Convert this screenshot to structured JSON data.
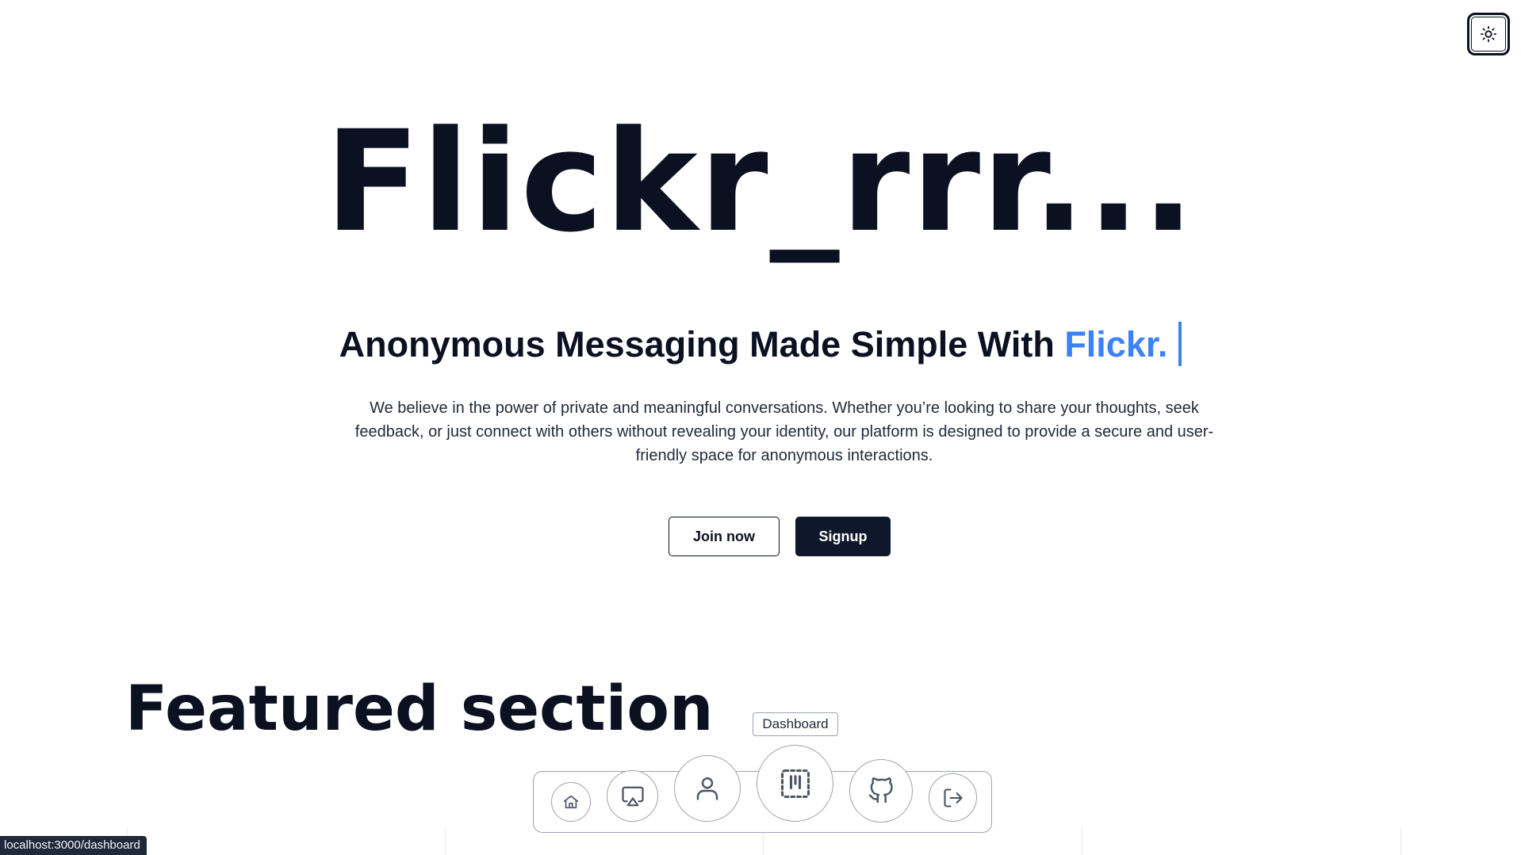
{
  "header": {
    "theme_toggle_icon": "sun-icon"
  },
  "hero": {
    "title": "Flickr_rrr...",
    "tagline_prefix": "Anonymous Messaging Made Simple With ",
    "tagline_brand": "Flickr.",
    "description": "We believe in the power of private and meaningful conversations. Whether you’re looking to share your thoughts, seek feedback, or just connect with others without revealing your identity, our platform is designed to provide a secure and user-friendly space for anonymous interactions.",
    "join_label": "Join now",
    "signup_label": "Signup"
  },
  "featured": {
    "title": "Featured section"
  },
  "dock": {
    "tooltip": "Dashboard",
    "items": [
      {
        "name": "Home",
        "icon": "home-icon"
      },
      {
        "name": "Screen",
        "icon": "airplay-icon"
      },
      {
        "name": "Profile",
        "icon": "user-icon"
      },
      {
        "name": "Dashboard",
        "icon": "dashboard-icon"
      },
      {
        "name": "GitHub",
        "icon": "github-icon"
      },
      {
        "name": "Logout",
        "icon": "logout-icon"
      }
    ]
  },
  "status_bar": {
    "url": "localhost:3000/dashboard"
  },
  "colors": {
    "text": "#0b1120",
    "accent": "#3b82f6",
    "button_dark": "#0f172a"
  }
}
